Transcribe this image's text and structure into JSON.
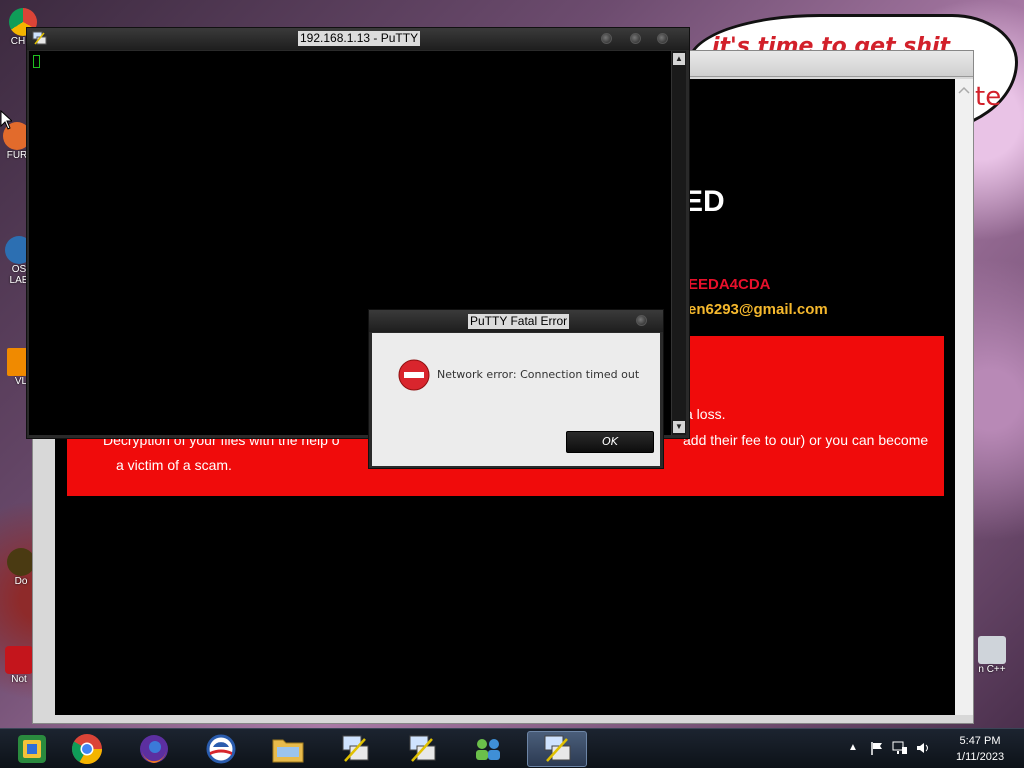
{
  "desktop": {
    "icons": [
      {
        "label": "CH D"
      },
      {
        "label": "FUR"
      },
      {
        "label": "OS LAE"
      },
      {
        "label": "VL"
      },
      {
        "label": "Do"
      },
      {
        "label": "Not"
      }
    ],
    "right_icon_label": "n C++",
    "bubble_text": "it's time to get shit",
    "bubble_text2": "te"
  },
  "ransom": {
    "heading": "ED",
    "id_fragment": "EEDA4CDA",
    "email_fragment": "en6293@gmail.com",
    "line1": "a loss.",
    "line2_left": "Decryption of your files with the help o",
    "line2_right": "add their fee to our) or you can become",
    "line3": "a victim of a scam."
  },
  "putty": {
    "title": "192.168.1.13 - PuTTY"
  },
  "error_dialog": {
    "title": "PuTTY Fatal Error",
    "message": "Network error: Connection timed out",
    "ok_label": "OK"
  },
  "taskbar": {
    "apps": [
      {
        "icon": "windows-explorer-icon"
      },
      {
        "icon": "chrome-icon"
      },
      {
        "icon": "firefox-icon"
      },
      {
        "icon": "obama-logo-icon"
      },
      {
        "icon": "folder-icon"
      },
      {
        "icon": "putty-icon"
      },
      {
        "icon": "putty-icon"
      },
      {
        "icon": "network-users-icon"
      },
      {
        "icon": "putty-icon"
      }
    ],
    "time": "5:47 PM",
    "date": "1/11/2023"
  },
  "colors": {
    "ransom_red": "#f00b0b",
    "ransom_id": "#e8102b",
    "ransom_email": "#f5b82d",
    "terminal_cursor": "#1fbf1f"
  }
}
